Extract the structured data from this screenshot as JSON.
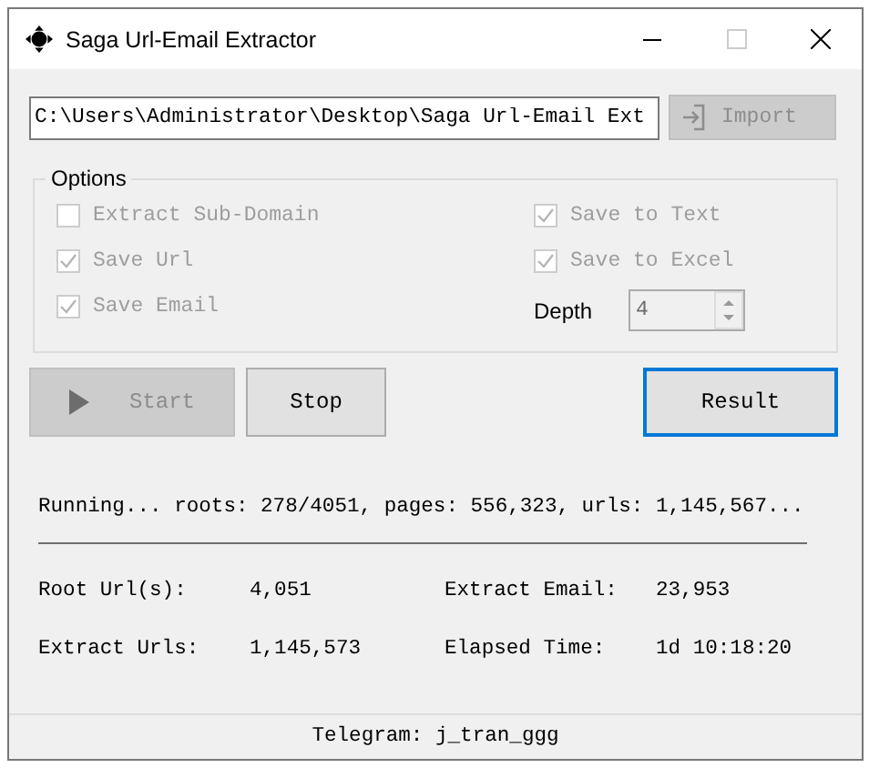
{
  "window": {
    "title": "Saga Url-Email Extractor"
  },
  "path_field": {
    "value": "C:\\Users\\Administrator\\Desktop\\Saga Url-Email Ext"
  },
  "import_button": {
    "label": "Import",
    "disabled": true
  },
  "options": {
    "title": "Options",
    "checkboxes": [
      {
        "label": "Extract Sub-Domain",
        "checked": false,
        "disabled": true
      },
      {
        "label": "Save to Text",
        "checked": true,
        "disabled": true
      },
      {
        "label": "Save Url",
        "checked": true,
        "disabled": true
      },
      {
        "label": "Save to Excel",
        "checked": true,
        "disabled": true
      },
      {
        "label": "Save Email",
        "checked": true,
        "disabled": true
      }
    ],
    "depth": {
      "label": "Depth",
      "value": "4",
      "disabled": true
    }
  },
  "buttons": [
    {
      "label": "Start",
      "kind": "play",
      "disabled": true,
      "focused": false
    },
    {
      "label": "Stop",
      "kind": "plain",
      "disabled": false,
      "focused": false
    },
    {
      "label": "Result",
      "kind": "plain",
      "disabled": false,
      "focused": true
    }
  ],
  "status_text": "Running... roots: 278/4051, pages: 556,323, urls: 1,145,567...",
  "stats": [
    {
      "label": "Root Url(s):",
      "value": "4,051"
    },
    {
      "label": "Extract Email:",
      "value": "23,953"
    },
    {
      "label": "Extract Urls:",
      "value": "1,145,573"
    },
    {
      "label": "Elapsed Time:",
      "value": "1d 10:18:20"
    }
  ],
  "footer": "Telegram: j_tran_ggg"
}
